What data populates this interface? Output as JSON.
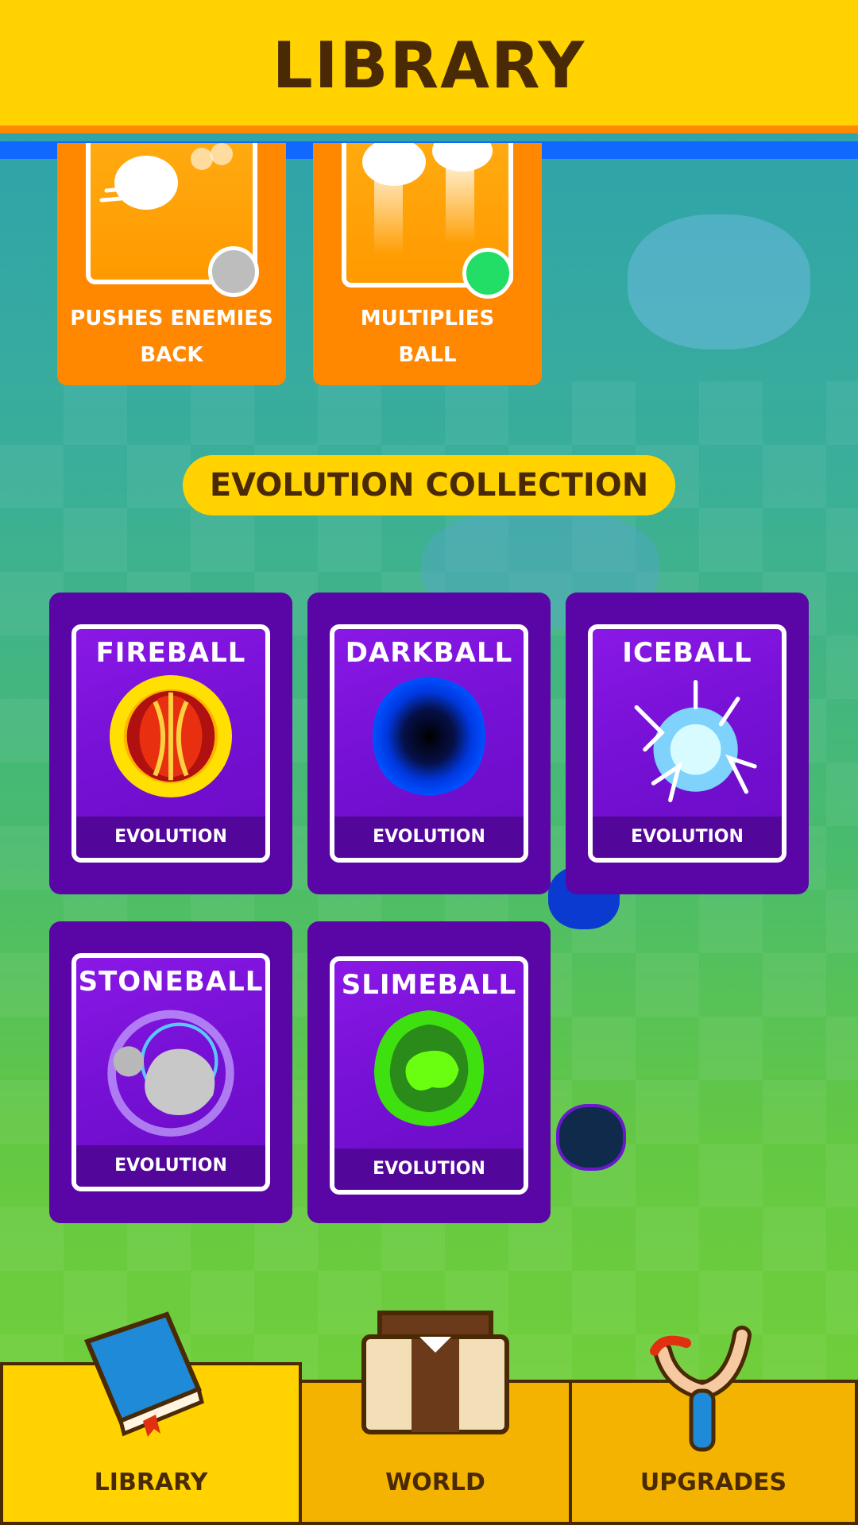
{
  "header": {
    "title": "LIBRARY"
  },
  "abilities": [
    {
      "text_line1": "PUSHES ENEMIES",
      "text_line2": "BACK",
      "rarity_color": "#bdbdbd"
    },
    {
      "text_line1": "MULTIPLIES",
      "text_line2": "BALL",
      "rarity_color": "#22dd66"
    }
  ],
  "section": {
    "title": "EVOLUTION COLLECTION"
  },
  "evolutions": [
    {
      "name": "FIREBALL",
      "tag": "EVOLUTION",
      "icon": "fireball-icon"
    },
    {
      "name": "DARKBALL",
      "tag": "EVOLUTION",
      "icon": "darkball-icon"
    },
    {
      "name": "ICEBALL",
      "tag": "EVOLUTION",
      "icon": "iceball-icon"
    },
    {
      "name": "STONEBALL",
      "tag": "EVOLUTION",
      "icon": "stoneball-icon"
    },
    {
      "name": "SLIMEBALL",
      "tag": "EVOLUTION",
      "icon": "slimeball-icon"
    }
  ],
  "nav": {
    "items": [
      {
        "label": "LIBRARY",
        "icon": "book-icon",
        "active": true
      },
      {
        "label": "WORLD",
        "icon": "castle-icon",
        "active": false
      },
      {
        "label": "UPGRADES",
        "icon": "slingshot-icon",
        "active": false
      }
    ]
  },
  "colors": {
    "header": "#ffd200",
    "header_stripe": "#1068ff",
    "ability_card": "#ff8800",
    "evolution_card": "#5a06a6",
    "text_dark": "#4a2a05"
  }
}
